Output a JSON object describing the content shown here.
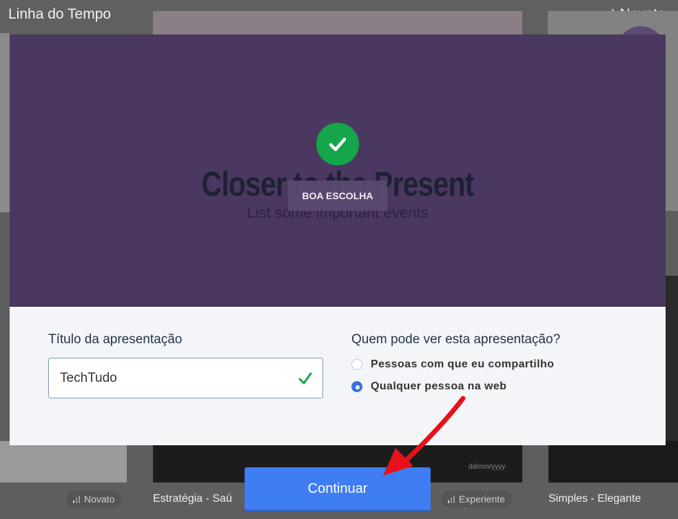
{
  "background": {
    "page_title": "Linha do Tempo",
    "top_level": "Novato",
    "captions": [
      "Estratégia - Saú",
      "Simples - Elegante"
    ],
    "pills": [
      "Novato",
      "Experiente"
    ],
    "date_hint": "dd/mm/yyyy"
  },
  "preview": {
    "slide_title": "Closer to the Present",
    "slide_subtitle": "List some important events",
    "badge": "BOA ESCOLHA",
    "accent": "#15a54a",
    "background_color": "#4a3860"
  },
  "form": {
    "title_label": "Título da apresentação",
    "title_value": "TechTudo",
    "visibility_label": "Quem pode ver esta apresentação?",
    "options": [
      {
        "label": "Pessoas com que eu compartilho",
        "selected": false
      },
      {
        "label": "Qualquer pessoa na web",
        "selected": true
      }
    ]
  },
  "actions": {
    "continue_label": "Continuar",
    "button_color": "#3e7df2"
  },
  "annotation": {
    "arrow_color": "#e8111a"
  }
}
